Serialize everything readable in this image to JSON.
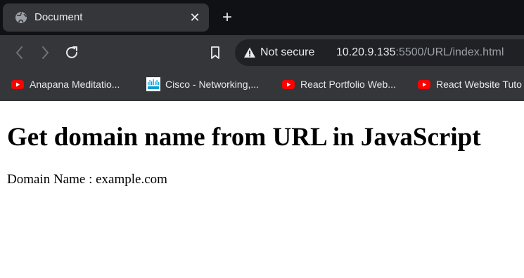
{
  "tab": {
    "title": "Document",
    "close_glyph": "✕",
    "icon": "globe-icon"
  },
  "new_tab_glyph": "+",
  "toolbar": {
    "back_icon": "back-arrow-icon",
    "forward_icon": "forward-arrow-icon",
    "reload_icon": "reload-icon",
    "bookmark_icon": "bookmark-icon",
    "security_label": "Not secure",
    "url_host": "10.20.9.135",
    "url_rest": ":5500/URL/index.html"
  },
  "bookmarks": [
    {
      "label": "Anapana Meditatio...",
      "icon": "youtube-icon"
    },
    {
      "label": "Cisco - Networking,...",
      "icon": "cisco-icon"
    },
    {
      "label": "React Portfolio Web...",
      "icon": "youtube-icon"
    },
    {
      "label": "React Website Tuto",
      "icon": "youtube-icon"
    }
  ],
  "page": {
    "heading": "Get domain name from URL in JavaScript",
    "domain_line": "Domain Name : example.com"
  },
  "colors": {
    "tab_strip": "#0f1114",
    "tab_active": "#35363a",
    "toolbar": "#35363a",
    "omnibox": "#202124",
    "youtube_red": "#ff0000",
    "cisco_blue": "#049fd9"
  }
}
